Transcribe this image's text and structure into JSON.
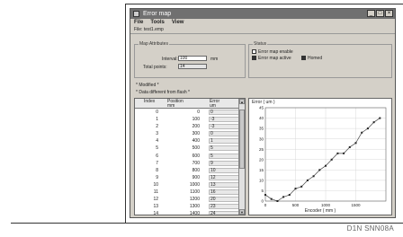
{
  "window": {
    "title": "Error map",
    "menu": [
      "File",
      "Tools",
      "View"
    ],
    "file_line": "File: test1.emp"
  },
  "map_attributes": {
    "group_title": "Map Attributes",
    "interval_label": "Interval:",
    "interval_value": "100",
    "interval_unit": "mm",
    "total_points_label": "Total points:",
    "total_points_value": "14"
  },
  "status": {
    "group_title": "Status",
    "error_map_enable": "Error map enable",
    "error_map_active": "Error map active",
    "homed": "Homed"
  },
  "notes": {
    "modified": "* Modified *",
    "data_different": "* Data different from flash *"
  },
  "table": {
    "headers": {
      "index": "Index",
      "position": "Position",
      "position_unit": "mm",
      "error": "Error",
      "error_unit": "um"
    },
    "rows": [
      {
        "index": "0",
        "position": "0",
        "error": "0"
      },
      {
        "index": "1",
        "position": "100",
        "error": "-3"
      },
      {
        "index": "2",
        "position": "200",
        "error": "-3"
      },
      {
        "index": "3",
        "position": "300",
        "error": "0"
      },
      {
        "index": "4",
        "position": "400",
        "error": "1"
      },
      {
        "index": "5",
        "position": "500",
        "error": "5"
      },
      {
        "index": "6",
        "position": "600",
        "error": "5"
      },
      {
        "index": "7",
        "position": "700",
        "error": "9"
      },
      {
        "index": "8",
        "position": "800",
        "error": "10"
      },
      {
        "index": "9",
        "position": "900",
        "error": "12"
      },
      {
        "index": "10",
        "position": "1000",
        "error": "13"
      },
      {
        "index": "11",
        "position": "1100",
        "error": "16"
      },
      {
        "index": "12",
        "position": "1200",
        "error": "20"
      },
      {
        "index": "13",
        "position": "1300",
        "error": "23"
      },
      {
        "index": "14",
        "position": "1400",
        "error": "24"
      }
    ]
  },
  "figure_code": "D1N SNN08A",
  "chart_data": {
    "type": "line",
    "title": "Error ( um )",
    "xlabel": "Encoder ( mm )",
    "ylabel": "",
    "x": [
      0,
      100,
      200,
      300,
      400,
      500,
      600,
      700,
      800,
      900,
      1000,
      1100,
      1200,
      1300,
      1400,
      1500,
      1600,
      1700,
      1800,
      1900
    ],
    "y": [
      3,
      1,
      0,
      2,
      3,
      6,
      7,
      10,
      12,
      15,
      17,
      20,
      23,
      23,
      26,
      28,
      33,
      35,
      38,
      40
    ],
    "xlim": [
      0,
      2000
    ],
    "ylim": [
      0,
      45
    ],
    "xticks": [
      0,
      500,
      1000,
      1500
    ],
    "yticks": [
      0,
      5,
      10,
      15,
      20,
      25,
      30,
      35,
      40,
      45
    ],
    "grid": true,
    "marker": "square"
  }
}
